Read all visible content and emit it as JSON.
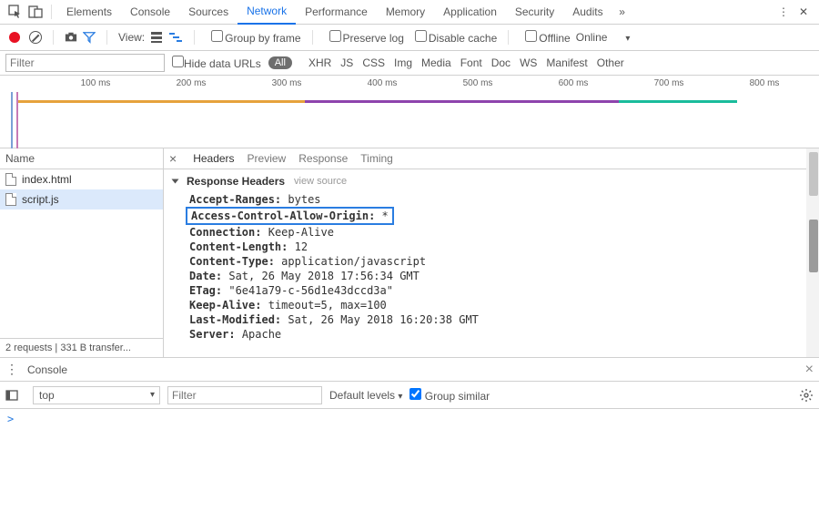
{
  "topTabs": [
    "Elements",
    "Console",
    "Sources",
    "Network",
    "Performance",
    "Memory",
    "Application",
    "Security",
    "Audits"
  ],
  "topActive": "Network",
  "toolbar": {
    "viewLabel": "View:",
    "groupByFrame": "Group by frame",
    "preserveLog": "Preserve log",
    "disableCache": "Disable cache",
    "offline": "Offline",
    "online": "Online"
  },
  "filterBar": {
    "placeholder": "Filter",
    "hideDataUrls": "Hide data URLs",
    "all": "All",
    "types": [
      "XHR",
      "JS",
      "CSS",
      "Img",
      "Media",
      "Font",
      "Doc",
      "WS",
      "Manifest",
      "Other"
    ]
  },
  "timeline": {
    "ticks": [
      "100 ms",
      "200 ms",
      "300 ms",
      "400 ms",
      "500 ms",
      "600 ms",
      "700 ms",
      "800 ms"
    ]
  },
  "left": {
    "header": "Name",
    "rows": [
      "index.html",
      "script.js"
    ],
    "selected": "script.js",
    "footer": "2 requests  |  331 B transfer..."
  },
  "detailTabs": [
    "Headers",
    "Preview",
    "Response",
    "Timing"
  ],
  "detailActive": "Headers",
  "section": {
    "title": "Response Headers",
    "viewSource": "view source"
  },
  "headers": [
    {
      "k": "Accept-Ranges:",
      "v": "bytes"
    },
    {
      "k": "Access-Control-Allow-Origin:",
      "v": "*",
      "boxed": true
    },
    {
      "k": "Connection:",
      "v": "Keep-Alive"
    },
    {
      "k": "Content-Length:",
      "v": "12"
    },
    {
      "k": "Content-Type:",
      "v": "application/javascript"
    },
    {
      "k": "Date:",
      "v": "Sat, 26 May 2018 17:56:34 GMT"
    },
    {
      "k": "ETag:",
      "v": "\"6e41a79-c-56d1e43dccd3a\""
    },
    {
      "k": "Keep-Alive:",
      "v": "timeout=5, max=100"
    },
    {
      "k": "Last-Modified:",
      "v": "Sat, 26 May 2018 16:20:38 GMT"
    },
    {
      "k": "Server:",
      "v": "Apache"
    }
  ],
  "console": {
    "drawerTab": "Console",
    "context": "top",
    "filterPlaceholder": "Filter",
    "levels": "Default levels",
    "groupSimilar": "Group similar",
    "prompt": ">"
  }
}
